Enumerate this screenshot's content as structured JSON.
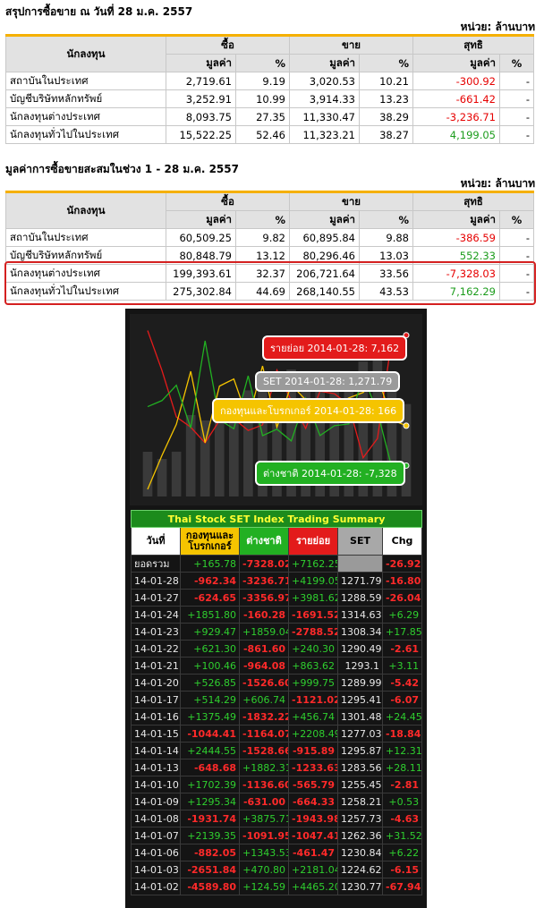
{
  "section1": {
    "title": "สรุปการซื้อขาย ณ วันที่ 28 ม.ค. 2557",
    "unit": "หน่วย: ล้านบาท",
    "headers": {
      "investor": "นักลงทุน",
      "buy": "ซื้อ",
      "sell": "ขาย",
      "net": "สุทธิ",
      "value": "มูลค่า",
      "pct": "%"
    },
    "rows": [
      {
        "name": "สถาบันในประเทศ",
        "buy": "2,719.61",
        "buy_pct": "9.19",
        "sell": "3,020.53",
        "sell_pct": "10.21",
        "net": "-300.92",
        "net_pct": "-"
      },
      {
        "name": "บัญชีบริษัทหลักทรัพย์",
        "buy": "3,252.91",
        "buy_pct": "10.99",
        "sell": "3,914.33",
        "sell_pct": "13.23",
        "net": "-661.42",
        "net_pct": "-"
      },
      {
        "name": "นักลงทุนต่างประเทศ",
        "buy": "8,093.75",
        "buy_pct": "27.35",
        "sell": "11,330.47",
        "sell_pct": "38.29",
        "net": "-3,236.71",
        "net_pct": "-"
      },
      {
        "name": "นักลงทุนทั่วไปในประเทศ",
        "buy": "15,522.25",
        "buy_pct": "52.46",
        "sell": "11,323.21",
        "sell_pct": "38.27",
        "net": "4,199.05",
        "net_pct": "-"
      }
    ]
  },
  "section2": {
    "title": "มูลค่าการซื้อขายสะสมในช่วง 1 - 28 ม.ค. 2557",
    "unit": "หน่วย: ล้านบาท",
    "headers": {
      "investor": "นักลงทุน",
      "buy": "ซื้อ",
      "sell": "ขาย",
      "net": "สุทธิ",
      "value": "มูลค่า",
      "pct": "%"
    },
    "rows": [
      {
        "name": "สถาบันในประเทศ",
        "buy": "60,509.25",
        "buy_pct": "9.82",
        "sell": "60,895.84",
        "sell_pct": "9.88",
        "net": "-386.59",
        "net_pct": "-"
      },
      {
        "name": "บัญชีบริษัทหลักทรัพย์",
        "buy": "80,848.79",
        "buy_pct": "13.12",
        "sell": "80,296.46",
        "sell_pct": "13.03",
        "net": "552.33",
        "net_pct": "-"
      },
      {
        "name": "นักลงทุนต่างประเทศ",
        "buy": "199,393.61",
        "buy_pct": "32.37",
        "sell": "206,721.64",
        "sell_pct": "33.56",
        "net": "-7,328.03",
        "net_pct": "-"
      },
      {
        "name": "นักลงทุนทั่วไปในประเทศ",
        "buy": "275,302.84",
        "buy_pct": "44.69",
        "sell": "268,140.55",
        "sell_pct": "43.53",
        "net": "7,162.29",
        "net_pct": "-"
      }
    ]
  },
  "chart": {
    "tooltips": {
      "retail": "รายย่อย 2014-01-28: 7,162",
      "set": "SET 2014-01-28: 1,271.79",
      "fund": "กองทุนและโบรกเกอร์ 2014-01-28: 166",
      "foreign": "ต่างชาติ 2014-01-28: -7,328"
    },
    "colors": {
      "retail": "#e31b1b",
      "set": "#9a9a9a",
      "fund": "#f5c400",
      "foreign": "#22b022"
    }
  },
  "chart_data": {
    "type": "line",
    "x": [
      "14-01-02",
      "14-01-03",
      "14-01-06",
      "14-01-07",
      "14-01-08",
      "14-01-09",
      "14-01-10",
      "14-01-13",
      "14-01-14",
      "14-01-15",
      "14-01-16",
      "14-01-17",
      "14-01-20",
      "14-01-21",
      "14-01-22",
      "14-01-23",
      "14-01-24",
      "14-01-27",
      "14-01-28"
    ],
    "series": [
      {
        "name": "รายย่อย",
        "values": [
          4465.2,
          2181.04,
          -461.47,
          -1047.41,
          -1943.98,
          -664.33,
          -565.79,
          -1233.63,
          -915.89,
          2208.49,
          456.74,
          -1121.02,
          999.75,
          863.62,
          240.3,
          -2788.52,
          -1691.52,
          3981.62,
          4199.05
        ]
      },
      {
        "name": "SET",
        "values": [
          1230.77,
          1224.62,
          1230.84,
          1262.36,
          1257.73,
          1258.21,
          1255.45,
          1283.56,
          1295.87,
          1277.03,
          1301.48,
          1295.41,
          1289.99,
          1293.1,
          1290.49,
          1308.34,
          1314.63,
          1288.59,
          1271.79
        ]
      },
      {
        "name": "กองทุนและโบรกเกอร์",
        "values": [
          -4589.8,
          -2651.84,
          -882.05,
          2139.35,
          -1931.74,
          1295.34,
          1702.39,
          -648.68,
          2444.55,
          -1044.41,
          1375.49,
          514.29,
          526.85,
          100.46,
          621.3,
          929.47,
          1851.8,
          -624.65,
          -962.34
        ]
      },
      {
        "name": "ต่างชาติ",
        "values": [
          124.59,
          470.8,
          1343.53,
          -1091.95,
          3875.71,
          -631.0,
          -1136.6,
          1882.31,
          -1528.66,
          -1164.07,
          -1832.22,
          606.74,
          -1526.6,
          -964.08,
          -861.6,
          1859.04,
          -160.28,
          -3356.97,
          -3236.71
        ]
      }
    ]
  },
  "trade": {
    "title": "Thai Stock SET Index Trading Summary",
    "headers": {
      "day": "วันที่",
      "fund": "กองทุนและโบรกเกอร์",
      "foreign": "ต่างชาติ",
      "retail": "รายย่อย",
      "set": "SET",
      "chg": "Chg"
    },
    "rows": [
      {
        "d": "ยอดรวม",
        "fund": "+165.78",
        "foreign": "-7328.02",
        "retail": "+7162.25",
        "set": "",
        "chg": "-26.92"
      },
      {
        "d": "14-01-28",
        "fund": "-962.34",
        "foreign": "-3236.71",
        "retail": "+4199.05",
        "set": "1271.79",
        "chg": "-16.80"
      },
      {
        "d": "14-01-27",
        "fund": "-624.65",
        "foreign": "-3356.97",
        "retail": "+3981.62",
        "set": "1288.59",
        "chg": "-26.04"
      },
      {
        "d": "14-01-24",
        "fund": "+1851.80",
        "foreign": "-160.28",
        "retail": "-1691.52",
        "set": "1314.63",
        "chg": "+6.29"
      },
      {
        "d": "14-01-23",
        "fund": "+929.47",
        "foreign": "+1859.04",
        "retail": "-2788.52",
        "set": "1308.34",
        "chg": "+17.85"
      },
      {
        "d": "14-01-22",
        "fund": "+621.30",
        "foreign": "-861.60",
        "retail": "+240.30",
        "set": "1290.49",
        "chg": "-2.61"
      },
      {
        "d": "14-01-21",
        "fund": "+100.46",
        "foreign": "-964.08",
        "retail": "+863.62",
        "set": "1293.1",
        "chg": "+3.11"
      },
      {
        "d": "14-01-20",
        "fund": "+526.85",
        "foreign": "-1526.60",
        "retail": "+999.75",
        "set": "1289.99",
        "chg": "-5.42"
      },
      {
        "d": "14-01-17",
        "fund": "+514.29",
        "foreign": "+606.74",
        "retail": "-1121.02",
        "set": "1295.41",
        "chg": "-6.07"
      },
      {
        "d": "14-01-16",
        "fund": "+1375.49",
        "foreign": "-1832.22",
        "retail": "+456.74",
        "set": "1301.48",
        "chg": "+24.45"
      },
      {
        "d": "14-01-15",
        "fund": "-1044.41",
        "foreign": "-1164.07",
        "retail": "+2208.49",
        "set": "1277.03",
        "chg": "-18.84"
      },
      {
        "d": "14-01-14",
        "fund": "+2444.55",
        "foreign": "-1528.66",
        "retail": "-915.89",
        "set": "1295.87",
        "chg": "+12.31"
      },
      {
        "d": "14-01-13",
        "fund": "-648.68",
        "foreign": "+1882.31",
        "retail": "-1233.63",
        "set": "1283.56",
        "chg": "+28.11"
      },
      {
        "d": "14-01-10",
        "fund": "+1702.39",
        "foreign": "-1136.60",
        "retail": "-565.79",
        "set": "1255.45",
        "chg": "-2.81"
      },
      {
        "d": "14-01-09",
        "fund": "+1295.34",
        "foreign": "-631.00",
        "retail": "-664.33",
        "set": "1258.21",
        "chg": "+0.53"
      },
      {
        "d": "14-01-08",
        "fund": "-1931.74",
        "foreign": "+3875.71",
        "retail": "-1943.98",
        "set": "1257.73",
        "chg": "-4.63"
      },
      {
        "d": "14-01-07",
        "fund": "+2139.35",
        "foreign": "-1091.95",
        "retail": "-1047.41",
        "set": "1262.36",
        "chg": "+31.52"
      },
      {
        "d": "14-01-06",
        "fund": "-882.05",
        "foreign": "+1343.53",
        "retail": "-461.47",
        "set": "1230.84",
        "chg": "+6.22"
      },
      {
        "d": "14-01-03",
        "fund": "-2651.84",
        "foreign": "+470.80",
        "retail": "+2181.04",
        "set": "1224.62",
        "chg": "-6.15"
      },
      {
        "d": "14-01-02",
        "fund": "-4589.80",
        "foreign": "+124.59",
        "retail": "+4465.20",
        "set": "1230.77",
        "chg": "-67.94"
      }
    ]
  }
}
